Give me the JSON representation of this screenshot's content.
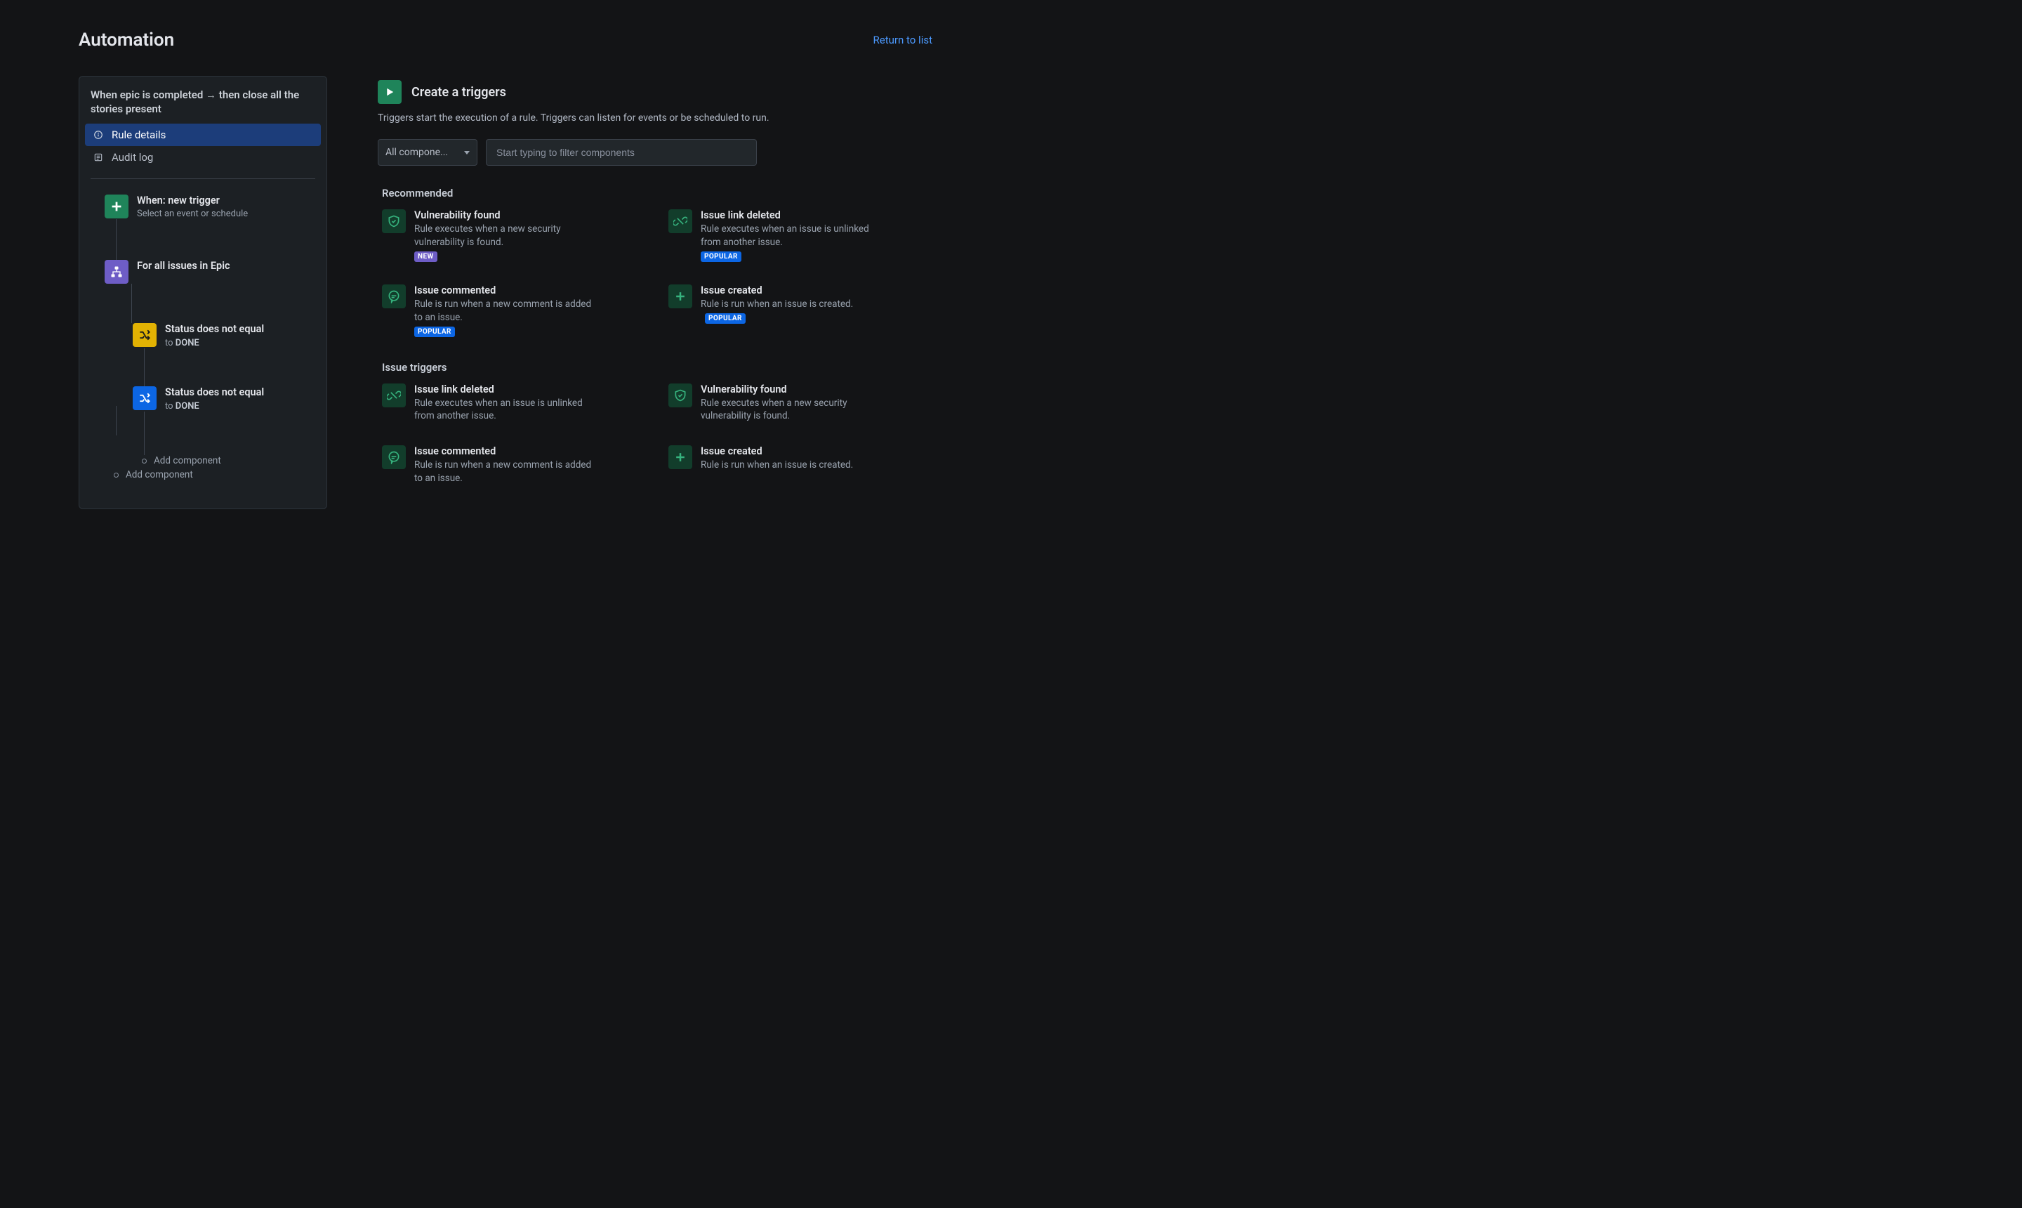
{
  "header": {
    "title": "Automation",
    "return_link": "Return to list"
  },
  "sidebar": {
    "rule_name_pre": "When epic is completed",
    "rule_name_post": "then close all the stories present",
    "nav": {
      "rule_details": "Rule details",
      "audit_log": "Audit log"
    },
    "flow": {
      "trigger_title": "When: new trigger",
      "trigger_sub": "Select an event or schedule",
      "branch_title": "For all issues in Epic",
      "cond1_title": "Status does not equal",
      "cond1_sub_pre": "to",
      "cond1_sub_val": "DONE",
      "cond2_title": "Status does not equal",
      "cond2_sub_pre": "to",
      "cond2_sub_val": "DONE",
      "add_component_inner": "Add component",
      "add_component_outer": "Add component"
    }
  },
  "right": {
    "heading": "Create a triggers",
    "description": "Triggers start the execution of a rule. Triggers can listen for events or be scheduled to run.",
    "filter_select": "All compone...",
    "filter_placeholder": "Start typing to filter components",
    "sections": {
      "recommended": "Recommended",
      "issue_triggers": "Issue triggers"
    },
    "badges": {
      "new": "NEW",
      "popular": "POPULAR"
    },
    "triggers": {
      "vuln_found": {
        "title": "Vulnerability found",
        "desc": "Rule executes when a new security vulnerability is found."
      },
      "link_deleted": {
        "title": "Issue link deleted",
        "desc": "Rule executes when an issue is unlinked from another issue."
      },
      "commented": {
        "title": "Issue commented",
        "desc": "Rule is run when a new comment is added to an issue."
      },
      "created": {
        "title": "Issue created",
        "desc": "Rule is run when an issue is created."
      }
    }
  }
}
